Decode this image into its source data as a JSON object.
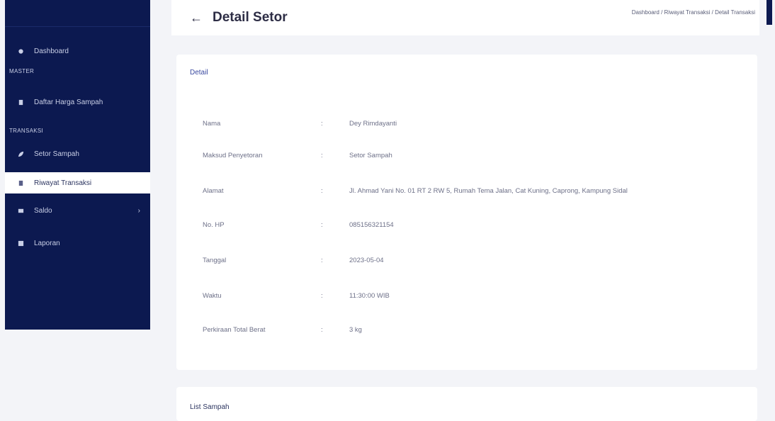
{
  "sidebar": {
    "items": [
      {
        "label": "Dashboard"
      },
      {
        "label": "Daftar Harga Sampah"
      },
      {
        "label": "Setor Sampah"
      },
      {
        "label": "Riwayat Transaksi"
      },
      {
        "label": "Saldo"
      },
      {
        "label": "Laporan"
      }
    ],
    "sections": [
      "MASTER",
      "TRANSAKSI"
    ]
  },
  "header": {
    "title": "Detail Setor",
    "breadcrumb": "Dashboard / Riwayat Transaksi / Detail Transaksi"
  },
  "detail": {
    "title": "Detail",
    "separator": ":",
    "rows": [
      {
        "label": "Nama",
        "value": "Dey Rimdayanti"
      },
      {
        "label": "Maksud Penyetoran",
        "value": "Setor Sampah"
      },
      {
        "label": "Alamat",
        "value": "Jl. Ahmad Yani No. 01 RT 2 RW 5, Rumah Tema Jalan, Cat Kuning, Caprong, Kampung Sidal"
      },
      {
        "label": "No. HP",
        "value": "085156321154"
      },
      {
        "label": "Tanggal",
        "value": "2023-05-04"
      },
      {
        "label": "Waktu",
        "value": "11:30:00 WIB"
      },
      {
        "label": "Perkiraan Total Berat",
        "value": "3 kg"
      }
    ]
  },
  "list": {
    "title": "List Sampah"
  },
  "colors": {
    "sidebar_bg": "#0c1950",
    "accent": "#3b4aa0",
    "page_bg": "#f3f4f8"
  }
}
